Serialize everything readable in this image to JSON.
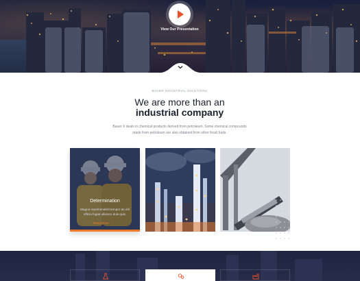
{
  "hero": {
    "video_label": "View Our Presentation"
  },
  "intro": {
    "eyebrow": "BAUER INDUSTRIAL SOLUTIONS",
    "heading_line1": "We are more than an",
    "heading_line2": "industrial company",
    "description": "Bauer X deals in chemical products derived from petroleum. Some chemical compounds made from petroleum are also obtained from other fossil fuels."
  },
  "cards": [
    {
      "title": "Determination",
      "description": "Magna reprehenderit tempor do elit officia fugiat ullamco duis quis.",
      "link": "Read More"
    }
  ],
  "colors": {
    "accent": "#f07a2c",
    "play_icon": "#e8512a",
    "dark_navy": "#1b1f2b"
  },
  "icons": {
    "play": "play-icon",
    "chevron": "chevron-down-icon",
    "arrow": "arrow-right-icon",
    "feature_left": "flask-icon",
    "feature_mid": "gears-icon",
    "feature_right": "factory-icon"
  }
}
